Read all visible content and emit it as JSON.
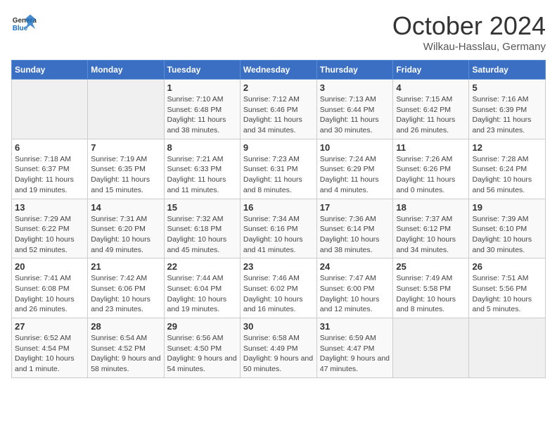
{
  "header": {
    "logo_general": "General",
    "logo_blue": "Blue",
    "month_title": "October 2024",
    "location": "Wilkau-Hasslau, Germany"
  },
  "weekdays": [
    "Sunday",
    "Monday",
    "Tuesday",
    "Wednesday",
    "Thursday",
    "Friday",
    "Saturday"
  ],
  "weeks": [
    [
      {
        "day": "",
        "info": ""
      },
      {
        "day": "",
        "info": ""
      },
      {
        "day": "1",
        "info": "Sunrise: 7:10 AM\nSunset: 6:48 PM\nDaylight: 11 hours and 38 minutes."
      },
      {
        "day": "2",
        "info": "Sunrise: 7:12 AM\nSunset: 6:46 PM\nDaylight: 11 hours and 34 minutes."
      },
      {
        "day": "3",
        "info": "Sunrise: 7:13 AM\nSunset: 6:44 PM\nDaylight: 11 hours and 30 minutes."
      },
      {
        "day": "4",
        "info": "Sunrise: 7:15 AM\nSunset: 6:42 PM\nDaylight: 11 hours and 26 minutes."
      },
      {
        "day": "5",
        "info": "Sunrise: 7:16 AM\nSunset: 6:39 PM\nDaylight: 11 hours and 23 minutes."
      }
    ],
    [
      {
        "day": "6",
        "info": "Sunrise: 7:18 AM\nSunset: 6:37 PM\nDaylight: 11 hours and 19 minutes."
      },
      {
        "day": "7",
        "info": "Sunrise: 7:19 AM\nSunset: 6:35 PM\nDaylight: 11 hours and 15 minutes."
      },
      {
        "day": "8",
        "info": "Sunrise: 7:21 AM\nSunset: 6:33 PM\nDaylight: 11 hours and 11 minutes."
      },
      {
        "day": "9",
        "info": "Sunrise: 7:23 AM\nSunset: 6:31 PM\nDaylight: 11 hours and 8 minutes."
      },
      {
        "day": "10",
        "info": "Sunrise: 7:24 AM\nSunset: 6:29 PM\nDaylight: 11 hours and 4 minutes."
      },
      {
        "day": "11",
        "info": "Sunrise: 7:26 AM\nSunset: 6:26 PM\nDaylight: 11 hours and 0 minutes."
      },
      {
        "day": "12",
        "info": "Sunrise: 7:28 AM\nSunset: 6:24 PM\nDaylight: 10 hours and 56 minutes."
      }
    ],
    [
      {
        "day": "13",
        "info": "Sunrise: 7:29 AM\nSunset: 6:22 PM\nDaylight: 10 hours and 52 minutes."
      },
      {
        "day": "14",
        "info": "Sunrise: 7:31 AM\nSunset: 6:20 PM\nDaylight: 10 hours and 49 minutes."
      },
      {
        "day": "15",
        "info": "Sunrise: 7:32 AM\nSunset: 6:18 PM\nDaylight: 10 hours and 45 minutes."
      },
      {
        "day": "16",
        "info": "Sunrise: 7:34 AM\nSunset: 6:16 PM\nDaylight: 10 hours and 41 minutes."
      },
      {
        "day": "17",
        "info": "Sunrise: 7:36 AM\nSunset: 6:14 PM\nDaylight: 10 hours and 38 minutes."
      },
      {
        "day": "18",
        "info": "Sunrise: 7:37 AM\nSunset: 6:12 PM\nDaylight: 10 hours and 34 minutes."
      },
      {
        "day": "19",
        "info": "Sunrise: 7:39 AM\nSunset: 6:10 PM\nDaylight: 10 hours and 30 minutes."
      }
    ],
    [
      {
        "day": "20",
        "info": "Sunrise: 7:41 AM\nSunset: 6:08 PM\nDaylight: 10 hours and 26 minutes."
      },
      {
        "day": "21",
        "info": "Sunrise: 7:42 AM\nSunset: 6:06 PM\nDaylight: 10 hours and 23 minutes."
      },
      {
        "day": "22",
        "info": "Sunrise: 7:44 AM\nSunset: 6:04 PM\nDaylight: 10 hours and 19 minutes."
      },
      {
        "day": "23",
        "info": "Sunrise: 7:46 AM\nSunset: 6:02 PM\nDaylight: 10 hours and 16 minutes."
      },
      {
        "day": "24",
        "info": "Sunrise: 7:47 AM\nSunset: 6:00 PM\nDaylight: 10 hours and 12 minutes."
      },
      {
        "day": "25",
        "info": "Sunrise: 7:49 AM\nSunset: 5:58 PM\nDaylight: 10 hours and 8 minutes."
      },
      {
        "day": "26",
        "info": "Sunrise: 7:51 AM\nSunset: 5:56 PM\nDaylight: 10 hours and 5 minutes."
      }
    ],
    [
      {
        "day": "27",
        "info": "Sunrise: 6:52 AM\nSunset: 4:54 PM\nDaylight: 10 hours and 1 minute."
      },
      {
        "day": "28",
        "info": "Sunrise: 6:54 AM\nSunset: 4:52 PM\nDaylight: 9 hours and 58 minutes."
      },
      {
        "day": "29",
        "info": "Sunrise: 6:56 AM\nSunset: 4:50 PM\nDaylight: 9 hours and 54 minutes."
      },
      {
        "day": "30",
        "info": "Sunrise: 6:58 AM\nSunset: 4:49 PM\nDaylight: 9 hours and 50 minutes."
      },
      {
        "day": "31",
        "info": "Sunrise: 6:59 AM\nSunset: 4:47 PM\nDaylight: 9 hours and 47 minutes."
      },
      {
        "day": "",
        "info": ""
      },
      {
        "day": "",
        "info": ""
      }
    ]
  ]
}
